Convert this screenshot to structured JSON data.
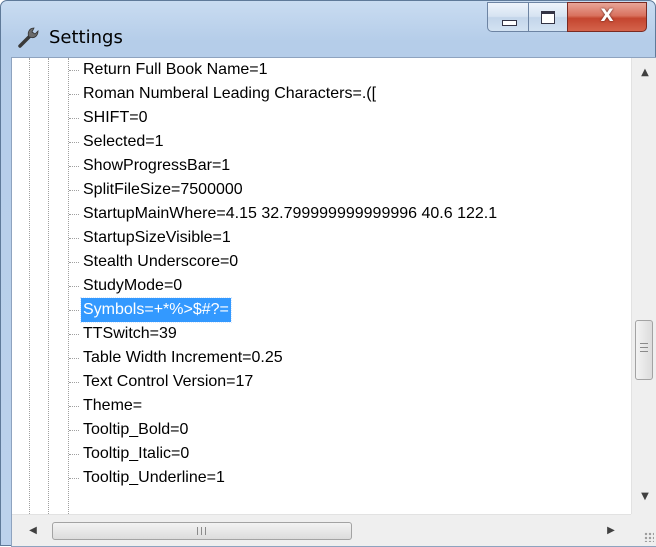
{
  "window": {
    "title": "Settings",
    "icon": "wrench-icon",
    "close_label": "X"
  },
  "tree": {
    "items": [
      {
        "label": "Return Full Book Name=1"
      },
      {
        "label": "Roman Numberal Leading Characters=.(["
      },
      {
        "label": "SHIFT=0"
      },
      {
        "label": "Selected=1"
      },
      {
        "label": "ShowProgressBar=1"
      },
      {
        "label": "SplitFileSize=7500000"
      },
      {
        "label": "StartupMainWhere=4.15 32.799999999999996 40.6 122.1"
      },
      {
        "label": "StartupSizeVisible=1"
      },
      {
        "label": "Stealth Underscore=0"
      },
      {
        "label": "StudyMode=0"
      },
      {
        "label": "Symbols=+*%>$#?=",
        "selected": true
      },
      {
        "label": "TTSwitch=39"
      },
      {
        "label": "Table Width Increment=0.25"
      },
      {
        "label": "Text Control Version=17"
      },
      {
        "label": "Theme="
      },
      {
        "label": "Tooltip_Bold=0"
      },
      {
        "label": "Tooltip_Italic=0"
      },
      {
        "label": "Tooltip_Underline=1"
      }
    ],
    "selected_color": "#3399ff"
  },
  "scrollbars": {
    "up_icon": "▲",
    "down_icon": "▼",
    "left_icon": "◀",
    "right_icon": "▶"
  }
}
